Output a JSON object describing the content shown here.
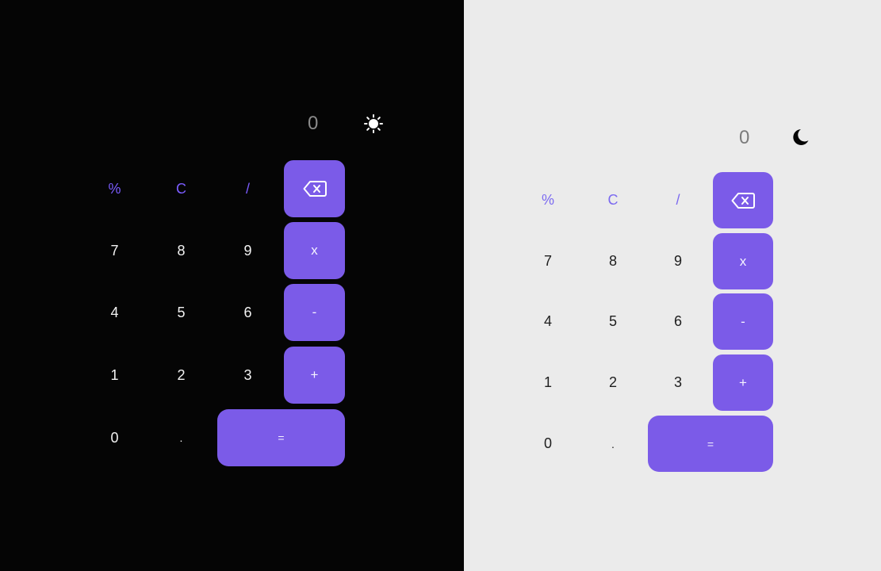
{
  "panels": [
    {
      "theme": "dark",
      "display_value": "0",
      "toggle_icon": "sun-icon",
      "keys": {
        "percent": "%",
        "clear": "C",
        "divide": "/",
        "backspace_icon": "backspace-icon",
        "seven": "7",
        "eight": "8",
        "nine": "9",
        "multiply": "x",
        "four": "4",
        "five": "5",
        "six": "6",
        "subtract": "-",
        "one": "1",
        "two": "2",
        "three": "3",
        "add": "+",
        "zero": "0",
        "decimal": ".",
        "equals": "="
      }
    },
    {
      "theme": "light",
      "display_value": "0",
      "toggle_icon": "moon-icon",
      "keys": {
        "percent": "%",
        "clear": "C",
        "divide": "/",
        "backspace_icon": "backspace-icon",
        "seven": "7",
        "eight": "8",
        "nine": "9",
        "multiply": "x",
        "four": "4",
        "five": "5",
        "six": "6",
        "subtract": "-",
        "one": "1",
        "two": "2",
        "three": "3",
        "add": "+",
        "zero": "0",
        "decimal": ".",
        "equals": "="
      }
    }
  ],
  "colors": {
    "accent": "#7b5be8",
    "dark_background": "#050505",
    "light_background": "#ebebeb"
  }
}
